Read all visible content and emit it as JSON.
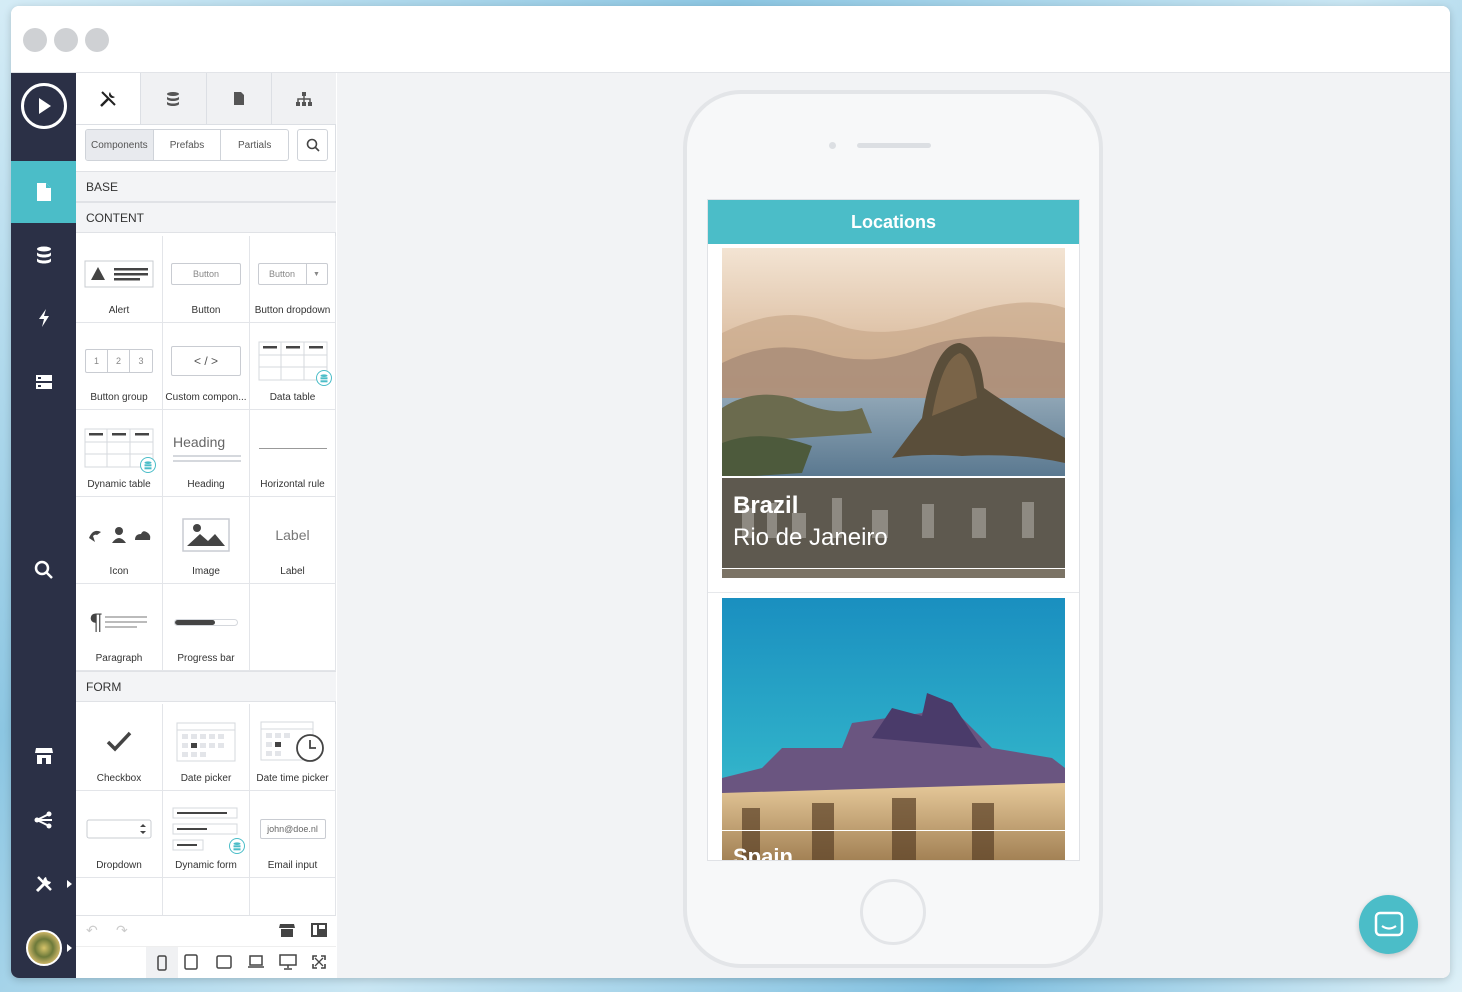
{
  "panel": {
    "segments": [
      "Components",
      "Prefabs",
      "Partials"
    ],
    "sections": {
      "base": "BASE",
      "content": "CONTENT",
      "form": "FORM"
    },
    "content_items": [
      {
        "label": "Alert",
        "icon": "alert-icon"
      },
      {
        "label": "Button",
        "icon": "button-icon",
        "preview": "Button"
      },
      {
        "label": "Button dropdown",
        "icon": "button-dropdown-icon",
        "preview": "Button"
      },
      {
        "label": "Button group",
        "icon": "button-group-icon",
        "preview": [
          "1",
          "2",
          "3"
        ]
      },
      {
        "label": "Custom compon...",
        "icon": "code-icon",
        "preview": "< / >"
      },
      {
        "label": "Data table",
        "icon": "data-table-icon"
      },
      {
        "label": "Dynamic table",
        "icon": "dynamic-table-icon"
      },
      {
        "label": "Heading",
        "icon": "heading-icon",
        "preview": "Heading"
      },
      {
        "label": "Horizontal rule",
        "icon": "horizontal-rule-icon"
      },
      {
        "label": "Icon",
        "icon": "icon-component-icon"
      },
      {
        "label": "Image",
        "icon": "image-icon"
      },
      {
        "label": "Label",
        "icon": "label-icon",
        "preview": "Label"
      },
      {
        "label": "Paragraph",
        "icon": "paragraph-icon"
      },
      {
        "label": "Progress bar",
        "icon": "progress-bar-icon",
        "progress": 0.65
      }
    ],
    "form_items": [
      {
        "label": "Checkbox",
        "icon": "checkbox-icon"
      },
      {
        "label": "Date picker",
        "icon": "date-picker-icon"
      },
      {
        "label": "Date time picker",
        "icon": "date-time-picker-icon"
      },
      {
        "label": "Dropdown",
        "icon": "dropdown-icon"
      },
      {
        "label": "Dynamic form",
        "icon": "dynamic-form-icon"
      },
      {
        "label": "Email input",
        "icon": "email-input-icon",
        "preview": "john@doe.nl"
      }
    ]
  },
  "app": {
    "header_title": "Locations",
    "cards": [
      {
        "country": "Brazil",
        "city": "Rio de Janeiro"
      },
      {
        "country": "Spain",
        "city": ""
      }
    ]
  },
  "colors": {
    "accent": "#4bbdc8",
    "rail": "#2b3046"
  }
}
